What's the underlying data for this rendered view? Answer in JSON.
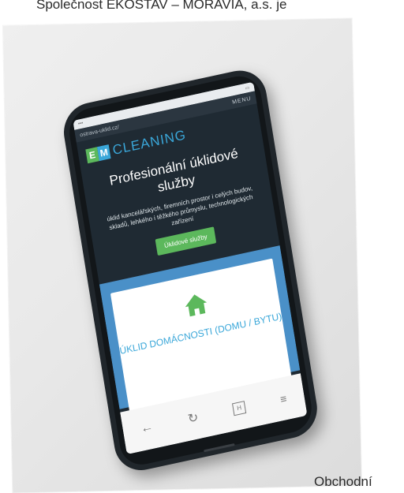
{
  "document": {
    "top_text": "Společnost EKOSTAV – MORAVIA, a.s. je",
    "bottom_text": "Obchodní"
  },
  "phone_screen": {
    "url": "ostrava-uklid.cz/",
    "menu_label": "MENU",
    "logo": {
      "mark_letters": [
        "E",
        "M"
      ],
      "text": "CLEANING"
    },
    "hero": {
      "title": "Profesionální úklidové služby",
      "description": "úklid kancelářských, firemních prostor i celých budov, skladů, lehkého i těžkého průmyslu, technologických zařízení",
      "cta_label": "Úklidové služby"
    },
    "card": {
      "icon": "house-icon",
      "title": "ÚKLID DOMÁCNOSTI (DOMU / BYTU)"
    },
    "browser_bar": {
      "back_icon": "back-arrow-icon",
      "reload_icon": "reload-icon",
      "tabs_icon": "tabs-icon",
      "menu_icon": "hamburger-icon"
    }
  },
  "colors": {
    "accent_green": "#5cb85c",
    "accent_blue": "#3aa7d9",
    "site_dark": "#1f2a33",
    "phone_body": "#20262b"
  }
}
